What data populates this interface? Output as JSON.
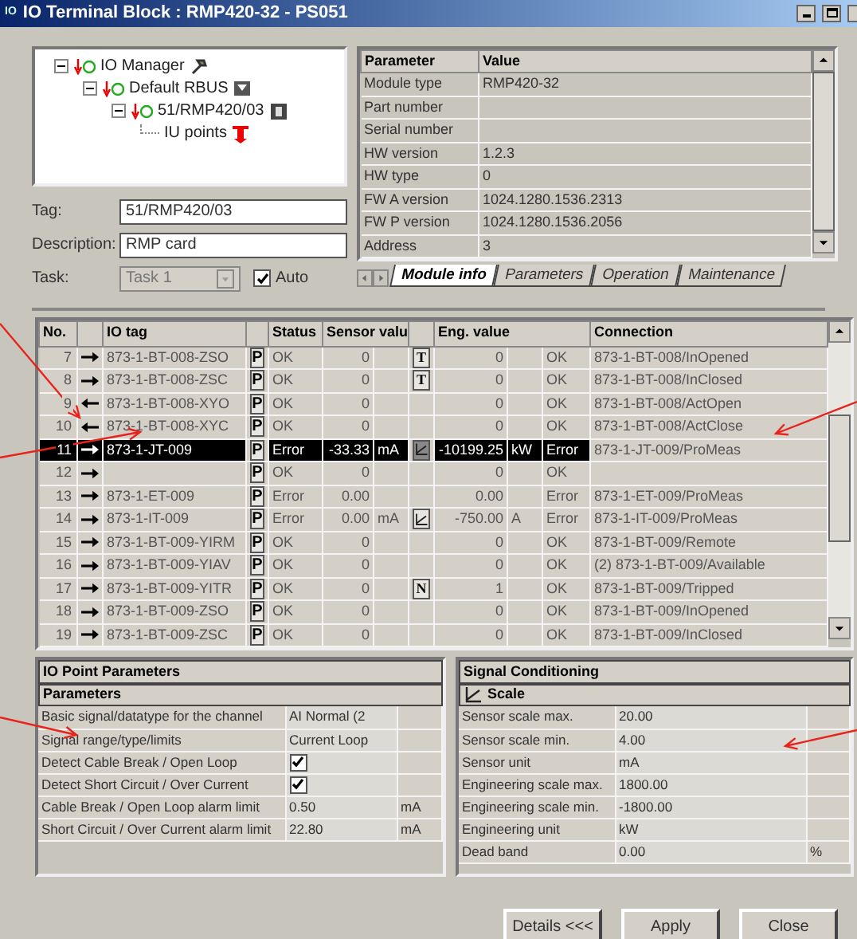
{
  "window": {
    "icon_text": "IO",
    "title": "IO Terminal Block : RMP420-32 - PS051"
  },
  "tree": [
    {
      "label": "IO Manager",
      "children": [
        {
          "label": "Default RBUS",
          "children": [
            {
              "label": "51/RMP420/03",
              "children": [
                {
                  "label": "IU points"
                }
              ]
            }
          ]
        }
      ]
    }
  ],
  "form": {
    "tag_label": "Tag:",
    "tag": "51/RMP420/03",
    "description_label": "Description:",
    "description": "RMP card",
    "task_label": "Task:",
    "task": "Task 1",
    "task_disabled": true,
    "auto_label": "Auto",
    "auto_checked": true
  },
  "module_table": {
    "columns": [
      "Parameter",
      "Value"
    ],
    "rows": [
      {
        "parameter": "Module type",
        "value": "RMP420-32"
      },
      {
        "parameter": "Part number"
      },
      {
        "parameter": "Serial number"
      },
      {
        "parameter": "HW version",
        "value": "1.2.3"
      },
      {
        "parameter": "HW type",
        "value": "0"
      },
      {
        "parameter": "FW A version",
        "value": "1024.1280.1536.2313"
      },
      {
        "parameter": "FW P version",
        "value": "1024.1280.1536.2056"
      },
      {
        "parameter": "Address",
        "value": "3"
      }
    ]
  },
  "tabs": [
    {
      "label": "Module info",
      "selected": true
    },
    {
      "label": "Parameters",
      "selected": false
    },
    {
      "label": "Operation",
      "selected": false
    },
    {
      "label": "Maintenance",
      "selected": false
    }
  ],
  "io_table": {
    "columns": [
      "No.",
      "IO tag",
      "Status",
      "Sensor valu",
      "Eng. value",
      "Connection"
    ],
    "rows": [
      {
        "no": "7",
        "kind": "in",
        "tag": "873-1-BT-008-ZSO",
        "p": "P",
        "status": "OK",
        "sensor_value": "0",
        "flag": {
          "kind": "letter",
          "text": "T"
        },
        "eng_value": "0",
        "eng_status": "OK",
        "connection": "873-1-BT-008/InOpened",
        "selected": false
      },
      {
        "no": "8",
        "kind": "in",
        "tag": "873-1-BT-008-ZSC",
        "p": "P",
        "status": "OK",
        "sensor_value": "0",
        "flag": {
          "kind": "letter",
          "text": "T"
        },
        "eng_value": "0",
        "eng_status": "OK",
        "connection": "873-1-BT-008/InClosed",
        "selected": false
      },
      {
        "no": "9",
        "kind": "out",
        "tag": "873-1-BT-008-XYO",
        "p": "P",
        "status": "OK",
        "sensor_value": "0",
        "eng_value": "0",
        "eng_status": "OK",
        "connection": "873-1-BT-008/ActOpen",
        "selected": false
      },
      {
        "no": "10",
        "kind": "out",
        "tag": "873-1-BT-008-XYC",
        "p": "P",
        "status": "OK",
        "sensor_value": "0",
        "eng_value": "0",
        "eng_status": "OK",
        "connection": "873-1-BT-008/ActClose",
        "selected": false
      },
      {
        "no": "11",
        "kind": "in",
        "tag": "873-1-JT-009",
        "p": "P",
        "status": "Error",
        "sensor_value": "-33.33",
        "sensor_unit": "mA",
        "flag": {
          "kind": "scale"
        },
        "eng_value": "-10199.25",
        "eng_unit": "kW",
        "eng_status": "Error",
        "connection": "873-1-JT-009/ProMeas",
        "selected": true
      },
      {
        "no": "12",
        "kind": "in",
        "p": "P",
        "status": "OK",
        "sensor_value": "0",
        "eng_value": "0",
        "eng_status": "OK",
        "selected": false
      },
      {
        "no": "13",
        "kind": "in",
        "tag": "873-1-ET-009",
        "p": "P",
        "status": "Error",
        "sensor_value": "0.00",
        "eng_value": "0.00",
        "eng_status": "Error",
        "connection": "873-1-ET-009/ProMeas",
        "selected": false
      },
      {
        "no": "14",
        "kind": "in",
        "tag": "873-1-IT-009",
        "p": "P",
        "status": "Error",
        "sensor_value": "0.00",
        "sensor_unit": "mA",
        "flag": {
          "kind": "scale"
        },
        "eng_value": "-750.00",
        "eng_unit": "A",
        "eng_status": "Error",
        "connection": "873-1-IT-009/ProMeas",
        "selected": false
      },
      {
        "no": "15",
        "kind": "in",
        "tag": "873-1-BT-009-YIRM",
        "p": "P",
        "status": "OK",
        "sensor_value": "0",
        "eng_value": "0",
        "eng_status": "OK",
        "connection": "873-1-BT-009/Remote",
        "selected": false
      },
      {
        "no": "16",
        "kind": "in",
        "tag": "873-1-BT-009-YIAV",
        "p": "P",
        "status": "OK",
        "sensor_value": "0",
        "eng_value": "0",
        "eng_status": "OK",
        "connection": "(2) 873-1-BT-009/Available",
        "selected": false
      },
      {
        "no": "17",
        "kind": "in",
        "tag": "873-1-BT-009-YITR",
        "p": "P",
        "status": "OK",
        "sensor_value": "0",
        "flag": {
          "kind": "letter",
          "text": "N"
        },
        "eng_value": "1",
        "eng_status": "OK",
        "connection": "873-1-BT-009/Tripped",
        "selected": false
      },
      {
        "no": "18",
        "kind": "in",
        "tag": "873-1-BT-009-ZSO",
        "p": "P",
        "status": "OK",
        "sensor_value": "0",
        "eng_value": "0",
        "eng_status": "OK",
        "connection": "873-1-BT-009/InOpened",
        "selected": false
      },
      {
        "no": "19",
        "kind": "in",
        "tag": "873-1-BT-009-ZSC",
        "p": "P",
        "status": "OK",
        "sensor_value": "0",
        "eng_value": "0",
        "eng_status": "OK",
        "connection": "873-1-BT-009/InClosed",
        "selected": false
      }
    ]
  },
  "io_point_parameters": {
    "title": "IO Point Parameters",
    "section": "Parameters",
    "rows": [
      {
        "kind": "text",
        "label": "Basic signal/datatype for the channel",
        "value": "AI Normal (2"
      },
      {
        "kind": "text",
        "label": "Signal range/type/limits",
        "value": "Current Loop"
      },
      {
        "kind": "checkbox",
        "label": "Detect Cable Break / Open Loop",
        "checked": true
      },
      {
        "kind": "checkbox",
        "label": "Detect Short Circuit / Over Current",
        "checked": true
      },
      {
        "kind": "text",
        "label": "Cable Break / Open Loop alarm limit",
        "value": "0.50",
        "unit": "mA"
      },
      {
        "kind": "text",
        "label": "Short Circuit / Over Current alarm limit",
        "value": "22.80",
        "unit": "mA"
      }
    ]
  },
  "signal_conditioning": {
    "title": "Signal Conditioning",
    "section": "Scale",
    "rows": [
      {
        "label": "Sensor scale max.",
        "value": "20.00"
      },
      {
        "label": "Sensor scale min.",
        "value": "4.00"
      },
      {
        "label": "Sensor unit",
        "value": "mA"
      },
      {
        "label": "Engineering scale max.",
        "value": "1800.00"
      },
      {
        "label": "Engineering scale min.",
        "value": "-1800.00"
      },
      {
        "label": "Engineering unit",
        "value": "kW"
      },
      {
        "label": "Dead band",
        "value": "0.00",
        "unit": "%"
      }
    ]
  },
  "buttons": [
    "Details <<<",
    "Apply",
    "Close"
  ]
}
